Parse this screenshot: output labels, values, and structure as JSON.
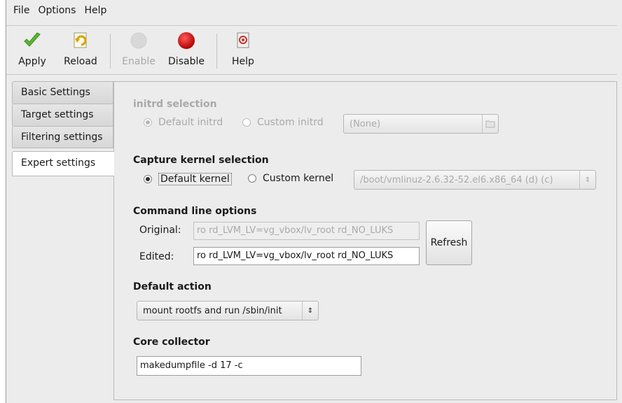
{
  "menubar": {
    "items": [
      {
        "label": "File"
      },
      {
        "label": "Options"
      },
      {
        "label": "Help"
      }
    ]
  },
  "toolbar": {
    "apply": {
      "label": "Apply",
      "icon": "checkmark-icon"
    },
    "reload": {
      "label": "Reload",
      "icon": "reload-icon"
    },
    "enable": {
      "label": "Enable",
      "icon": "enable-icon",
      "disabled": true
    },
    "disable": {
      "label": "Disable",
      "icon": "red-circle-icon"
    },
    "help": {
      "label": "Help",
      "icon": "help-book-icon"
    }
  },
  "tabs": [
    {
      "label": "Basic Settings"
    },
    {
      "label": "Target settings"
    },
    {
      "label": "Filtering settings"
    },
    {
      "label": "Expert settings",
      "active": true
    }
  ],
  "initrd": {
    "title": "initrd selection",
    "default_label": "Default initrd",
    "custom_label": "Custom initrd",
    "selected": "default",
    "combo_value": "(None)"
  },
  "kernel": {
    "title": "Capture kernel selection",
    "default_label": "Default kernel",
    "custom_label": "Custom kernel",
    "selected": "default",
    "combo_value": "/boot/vmlinuz-2.6.32-52.el6.x86_64 (d) (c)"
  },
  "cmdline": {
    "title": "Command line options",
    "original_label": "Original:",
    "original_value": "ro rd_LVM_LV=vg_vbox/lv_root rd_NO_LUKS",
    "edited_label": "Edited:",
    "edited_value": "ro rd_LVM_LV=vg_vbox/lv_root rd_NO_LUKS",
    "refresh_label": "Refresh"
  },
  "default_action": {
    "title": "Default action",
    "value": "mount rootfs and run /sbin/init"
  },
  "core_collector": {
    "title": "Core collector",
    "value": "makedumpfile -d 17 -c"
  },
  "colors": {
    "window_bg": "#ececec",
    "apply_green": "#5cb82e",
    "disable_red": "#d40000",
    "disabled_text": "#a9a9a9"
  }
}
